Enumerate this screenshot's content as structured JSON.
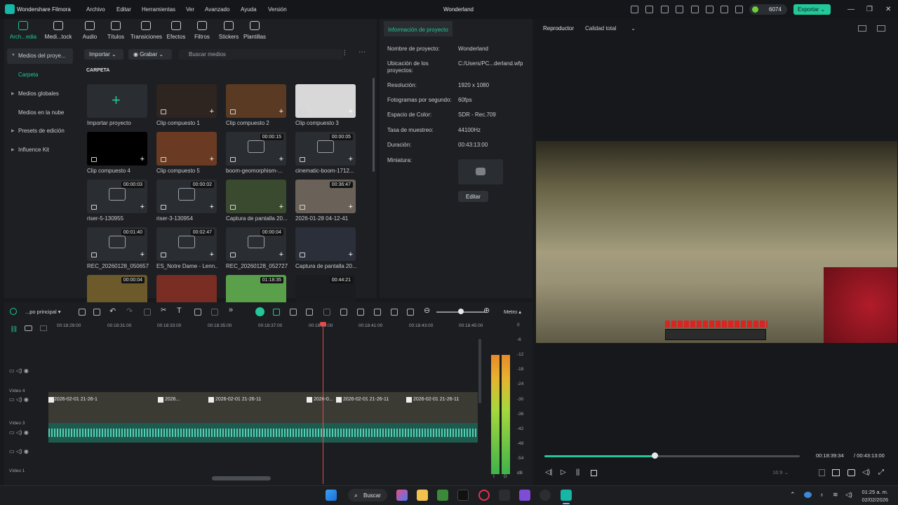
{
  "titlebar": {
    "app_name": "Wondershare Filmora",
    "project": "Wonderland",
    "menus": [
      "Archivo",
      "Editar",
      "Herramientas",
      "Ver",
      "Avanzado",
      "Ayuda",
      "Versión"
    ],
    "credits": "6074",
    "export_label": "Exportar",
    "window": {
      "minimize": "—",
      "maximize": "❐",
      "close": "✕"
    }
  },
  "toolbar": {
    "items": [
      "Arch...edia",
      "Medi...tock",
      "Audio",
      "Títulos",
      "Transiciones",
      "Efectos",
      "Filtros",
      "Stickers",
      "Plantillas"
    ]
  },
  "sidebar": {
    "items": [
      "Medios del proye...",
      "Carpeta",
      "Medios globales",
      "Medios en la nube",
      "Presets de edición",
      "Influence Kit"
    ]
  },
  "media": {
    "import_label": "Importar",
    "record_label": "Grabar",
    "search_placeholder": "Buscar medios",
    "folder_title": "CARPETA",
    "tiles": [
      {
        "label": "Importar proyecto",
        "duration": ""
      },
      {
        "label": "Clip compuesto 1",
        "duration": ""
      },
      {
        "label": "Clip compuesto 2",
        "duration": ""
      },
      {
        "label": "Clip compuesto 3",
        "duration": ""
      },
      {
        "label": "Clip compuesto 4",
        "duration": ""
      },
      {
        "label": "Clip compuesto 5",
        "duration": ""
      },
      {
        "label": "boom-geomorphism-...",
        "duration": "00:00:15"
      },
      {
        "label": "cinematic-boom-1712...",
        "duration": "00:00:05"
      },
      {
        "label": "riser-5-130955",
        "duration": "00:00:03"
      },
      {
        "label": "riser-3-130954",
        "duration": "00:00:02"
      },
      {
        "label": "Captura de pantalla 20...",
        "duration": ""
      },
      {
        "label": "2026-01-28 04-12-41",
        "duration": "00:36:47"
      },
      {
        "label": "REC_20260128_050657",
        "duration": "00:01:40"
      },
      {
        "label": "ES_Notre Dame - Lenn...",
        "duration": "00:02:47"
      },
      {
        "label": "REC_20260128_052727",
        "duration": "00:00:04"
      },
      {
        "label": "Captura de pantalla 20...",
        "duration": ""
      },
      {
        "label": "",
        "duration": "00:00:04"
      },
      {
        "label": "",
        "duration": ""
      },
      {
        "label": "",
        "duration": "01:18:35"
      },
      {
        "label": "",
        "duration": "00:44:21"
      }
    ]
  },
  "info": {
    "tab": "Información de proyecto",
    "rows": [
      {
        "k": "Nombre de proyecto:",
        "v": "Wonderland"
      },
      {
        "k": "Ubicación de los proyectos:",
        "v": "C:/Users/PC...derland.wfp"
      },
      {
        "k": "Resolución:",
        "v": "1920 x 1080"
      },
      {
        "k": "Fotogramas por segundo:",
        "v": "60fps"
      },
      {
        "k": "Espacio de Color:",
        "v": "SDR - Rec.709"
      },
      {
        "k": "Tasa de muestreo:",
        "v": "44100Hz"
      },
      {
        "k": "Duración:",
        "v": "00:43:13:00"
      },
      {
        "k": "Miniatura:",
        "v": ""
      }
    ],
    "edit_label": "Editar"
  },
  "player": {
    "label": "Reproductor",
    "quality": "Calidad total",
    "current": "00:18:39:34",
    "total": "/ 00:43:13:00",
    "ratio": "16:9",
    "progress": 0.43
  },
  "timeline": {
    "sequence": "...po principal",
    "scale_label": "Metro",
    "ruler": [
      "00:18:29:00",
      "00:18:31:00",
      "00:18:33:00",
      "00:18:35:00",
      "00:18:37:00",
      "00:18:39:00",
      "00:18:41:00",
      "00:18:43:00",
      "00:18:45:00"
    ],
    "tracks": [
      "Vídeo 4",
      "Vídeo 3",
      "Vídeo 1"
    ],
    "clips": [
      "2026-02-01 21-26-1",
      "2026...",
      "2026-02-01 21-26-11",
      "2026-0...",
      "2026-02-01 21-26-11",
      "2026-02-01 21-26-11"
    ],
    "db": [
      "0",
      "-6",
      "-12",
      "-18",
      "-24",
      "-30",
      "-36",
      "-42",
      "-48",
      "-54",
      "dB"
    ],
    "lr": [
      "I",
      "D"
    ]
  },
  "taskbar": {
    "search": "Buscar",
    "time": "01:25 a. m.",
    "date": "02/02/2026"
  }
}
